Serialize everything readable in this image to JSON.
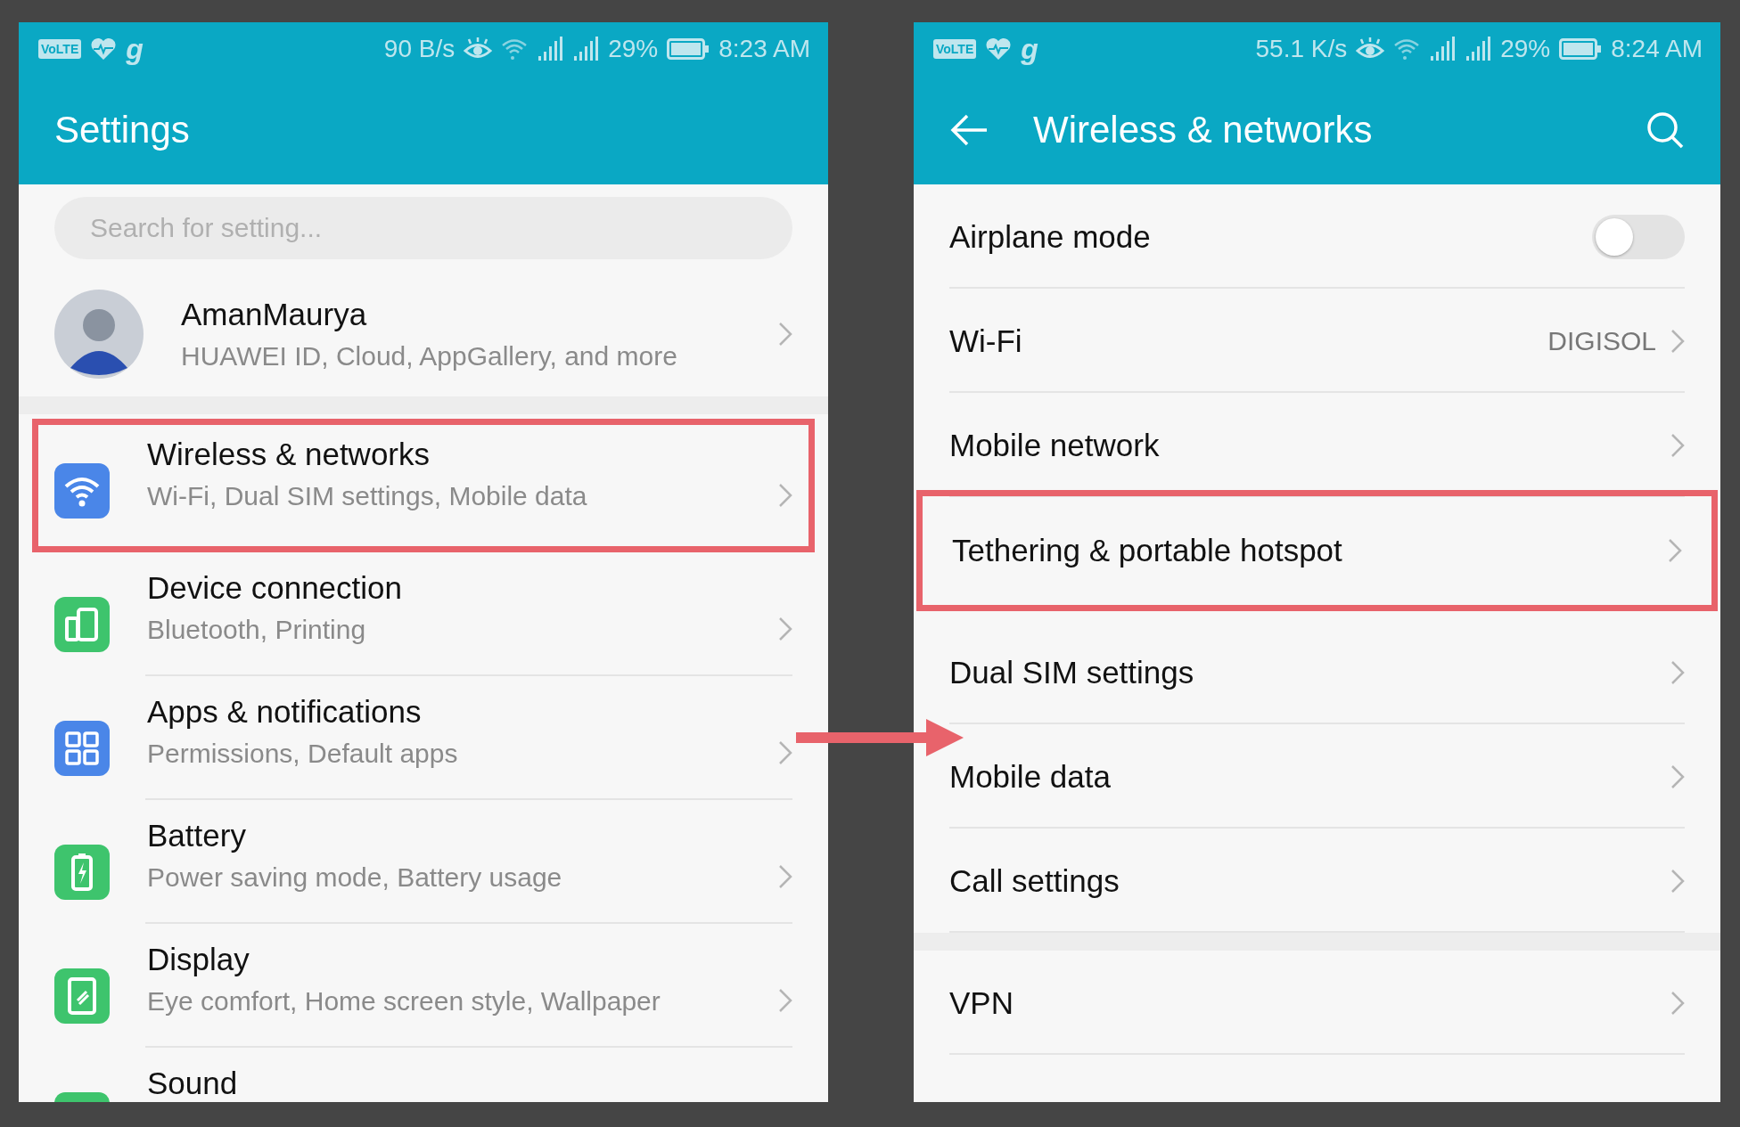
{
  "left_screen": {
    "status_bar": {
      "volte": "VoLTE",
      "app_letter": "g",
      "data_rate": "90 B/s",
      "battery": "29%",
      "time": "8:23 AM"
    },
    "title": "Settings",
    "search": {
      "placeholder": "Search for setting..."
    },
    "profile": {
      "name": "AmanMaurya",
      "subtitle": "HUAWEI ID, Cloud, AppGallery, and more"
    },
    "items": [
      {
        "kind": "wifi",
        "color": "#4a86e8",
        "title": "Wireless & networks",
        "subtitle": "Wi-Fi, Dual SIM settings, Mobile data",
        "highlighted": true
      },
      {
        "kind": "device",
        "color": "#3ec46d",
        "title": "Device connection",
        "subtitle": "Bluetooth, Printing",
        "highlighted": false
      },
      {
        "kind": "apps",
        "color": "#4a86e8",
        "title": "Apps & notifications",
        "subtitle": "Permissions, Default apps",
        "highlighted": false
      },
      {
        "kind": "battery",
        "color": "#3ec46d",
        "title": "Battery",
        "subtitle": "Power saving mode, Battery usage",
        "highlighted": false
      },
      {
        "kind": "display",
        "color": "#3ec46d",
        "title": "Display",
        "subtitle": "Eye comfort, Home screen style, Wallpaper",
        "highlighted": false
      },
      {
        "kind": "sound",
        "color": "#3ec46d",
        "title": "Sound",
        "highlighted": false
      }
    ]
  },
  "right_screen": {
    "status_bar": {
      "volte": "VoLTE",
      "app_letter": "g",
      "data_rate": "55.1 K/s",
      "battery": "29%",
      "time": "8:24 AM"
    },
    "title": "Wireless & networks",
    "groups": [
      {
        "items": [
          {
            "kind": "toggle",
            "title": "Airplane mode",
            "on": false,
            "highlighted": false
          },
          {
            "kind": "link",
            "title": "Wi-Fi",
            "value": "DIGISOL",
            "highlighted": false
          },
          {
            "kind": "link",
            "title": "Mobile network",
            "highlighted": false
          },
          {
            "kind": "link",
            "title": "Tethering & portable hotspot",
            "highlighted": true
          },
          {
            "kind": "link",
            "title": "Dual SIM settings",
            "highlighted": false
          },
          {
            "kind": "link",
            "title": "Mobile data",
            "highlighted": false
          },
          {
            "kind": "link",
            "title": "Call settings",
            "highlighted": false
          }
        ]
      },
      {
        "items": [
          {
            "kind": "link",
            "title": "VPN",
            "highlighted": false
          }
        ]
      }
    ]
  }
}
